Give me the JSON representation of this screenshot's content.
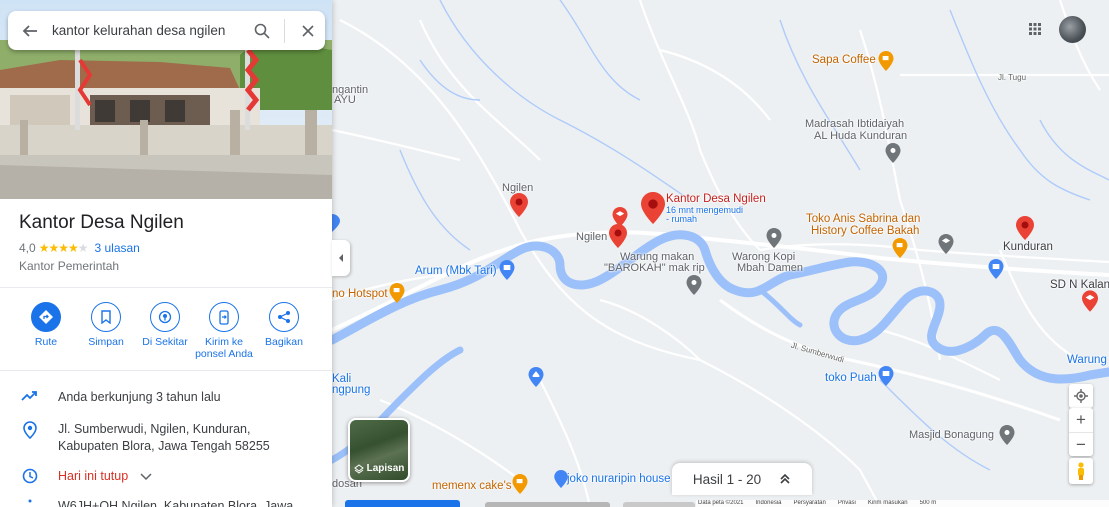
{
  "search": {
    "query": "kantor kelurahan desa ngilen"
  },
  "place": {
    "name": "Kantor Desa Ngilen",
    "rating": "4,0",
    "rating_value": 4.0,
    "reviews": "3 ulasan",
    "category": "Kantor Pemerintah"
  },
  "actions": [
    {
      "label": "Rute",
      "icon": "directions-icon"
    },
    {
      "label": "Simpan",
      "icon": "bookmark-icon"
    },
    {
      "label": "Di Sekitar",
      "icon": "nearby-icon"
    },
    {
      "label": "Kirim ke ponsel Anda",
      "icon": "send-to-phone-icon"
    },
    {
      "label": "Bagikan",
      "icon": "share-icon"
    }
  ],
  "info": {
    "visited": "Anda berkunjung 3 tahun lalu",
    "address": "Jl. Sumberwudi, Ngilen, Kunduran, Kabupaten Blora, Jawa Tengah 58255",
    "hours": "Hari ini tutup",
    "plus_code": "W6JH+QH Ngilen, Kabupaten Blora, Jawa"
  },
  "map": {
    "labels": {
      "sapa_coffee": "Sapa Coffee",
      "jl_tugu": "Jl. Tugu",
      "ngantin": "ngantin",
      "ayu": "AYU",
      "madrasah_1": "Madrasah Ibtidaiyah",
      "madrasah_2": "AL Huda Kunduran",
      "ngilen_top": "Ngilen",
      "ngilen_mid": "Ngilen",
      "kantor": "Kantor Desa Ngilen",
      "kantor_sub1": "16 mnt mengemudi",
      "kantor_sub2": "- rumah",
      "toko_anis_1": "Toko Anis Sabrina dan",
      "toko_anis_2": "History Coffee Bakah",
      "warong_makan_1": "Warung makan",
      "warong_makan_2": "\"BAROKAH\" mak rip",
      "warong_kopi_1": "Warong Kopi",
      "warong_kopi_2": "Mbah Damen",
      "kunduran": "Kunduran",
      "sdn_kalang": "SD N Kalang",
      "arum": "Arum (Mbk Tari)",
      "hotspot": "no Hotspot",
      "warung_right": "Warung",
      "jl_sumberwudi": "Jl. Sumberwudi",
      "toko_puah": "toko Puah",
      "kali_1": "Kali",
      "kali_2": "ngpung",
      "masjid": "Masjid Bonagung",
      "memenx": "memenx cake's",
      "joko": "joko nuraripin house",
      "dosan": "dosan"
    }
  },
  "controls": {
    "layers": "Lapisan",
    "results": "Hasil 1 - 20",
    "zoom_in": "+",
    "zoom_out": "−"
  },
  "footer": [
    "Data peta ©2021",
    "Indonesia",
    "Persyaratan",
    "Privasi",
    "Kirim masukan",
    "500 m"
  ]
}
